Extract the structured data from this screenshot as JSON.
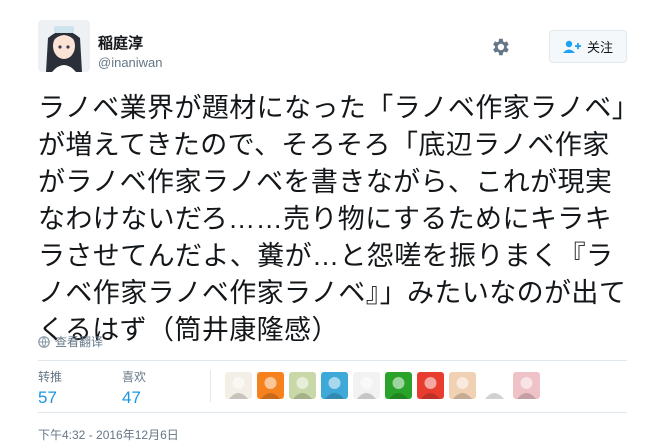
{
  "user": {
    "name": "稲庭淳",
    "handle": "@inaniwan"
  },
  "follow_button": {
    "label": "关注"
  },
  "tweet": {
    "text": "ラノベ業界が題材になった「ラノベ作家ラノベ」が増えてきたので、そろそろ「底辺ラノベ作家がラノベ作家ラノベを書きながら、これが現実なわけないだろ……売り物にするためにキラキラさせてんだよ、糞が…と怨嗟を振りまく『ラノベ作家ラノベ作家ラノベ』」みたいなのが出てくるはず（筒井康隆感）",
    "translate_label": "查看翻译"
  },
  "stats": {
    "retweets_label": "转推",
    "retweets_value": "57",
    "likes_label": "喜欢",
    "likes_value": "47"
  },
  "likers": [
    {
      "icon": "witch-avatar",
      "color": "#f4efe6"
    },
    {
      "icon": "egg-avatar",
      "color": "#f5821f"
    },
    {
      "icon": "anime-avatar",
      "color": "#c9d8a9"
    },
    {
      "icon": "cat-avatar",
      "color": "#3ea8d8"
    },
    {
      "icon": "sketch-avatar",
      "color": "#f2f2f2"
    },
    {
      "icon": "green-character-avatar",
      "color": "#29a329"
    },
    {
      "icon": "red-character-avatar",
      "color": "#e83c2f"
    },
    {
      "icon": "girl-avatar",
      "color": "#f1d1b4"
    },
    {
      "icon": "santa-avatar",
      "color": "#ffffff"
    },
    {
      "icon": "pink-avatar",
      "color": "#efc2c8"
    }
  ],
  "timestamp": "下午4:32 - 2016年12月6日"
}
